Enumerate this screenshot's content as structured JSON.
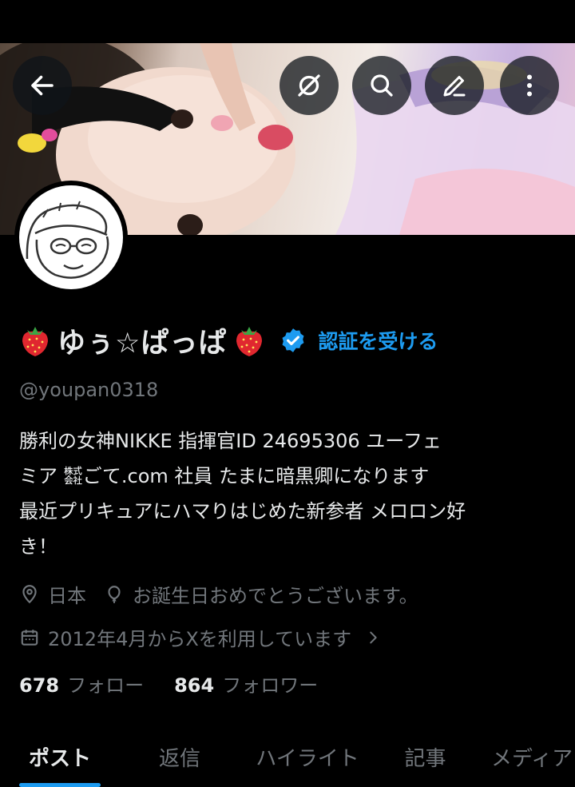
{
  "profile": {
    "display_name": "ゆぅ☆ぱっぱ",
    "verify_label": "認証を受ける",
    "handle": "@youpan0318",
    "bio_lines": [
      "勝利の女神NIKKE 指揮官ID 24695306 ユーフェ",
      "ミア ㍿ごて.com 社員 たまに暗黒卿になります",
      "最近プリキュアにハマりはじめた新参者 メロロン好",
      "き！"
    ],
    "location": "日本",
    "birthday": "お誕生日おめでとうございます。",
    "joined": "2012年4月からXを利用しています"
  },
  "stats": {
    "following_count": "678",
    "following_label": "フォロー",
    "followers_count": "864",
    "followers_label": "フォロワー"
  },
  "tabs": [
    {
      "label": "ポスト",
      "active": true
    },
    {
      "label": "返信",
      "active": false
    },
    {
      "label": "ハイライト",
      "active": false
    },
    {
      "label": "記事",
      "active": false
    },
    {
      "label": "メディア",
      "active": false
    }
  ],
  "icons": {
    "back": "arrow-left-icon",
    "grok": "grok-icon",
    "search": "search-icon",
    "edit": "pencil-icon",
    "more": "more-vertical-icon",
    "verified": "verified-badge-icon",
    "location": "location-pin-icon",
    "birthday": "balloon-icon",
    "calendar": "calendar-icon",
    "chevron": "chevron-right-icon",
    "strawberry": "strawberry-emoji"
  },
  "colors": {
    "background": "#000000",
    "text_primary": "#e7e9ea",
    "text_secondary": "#71767b",
    "accent": "#1d9bf0"
  }
}
